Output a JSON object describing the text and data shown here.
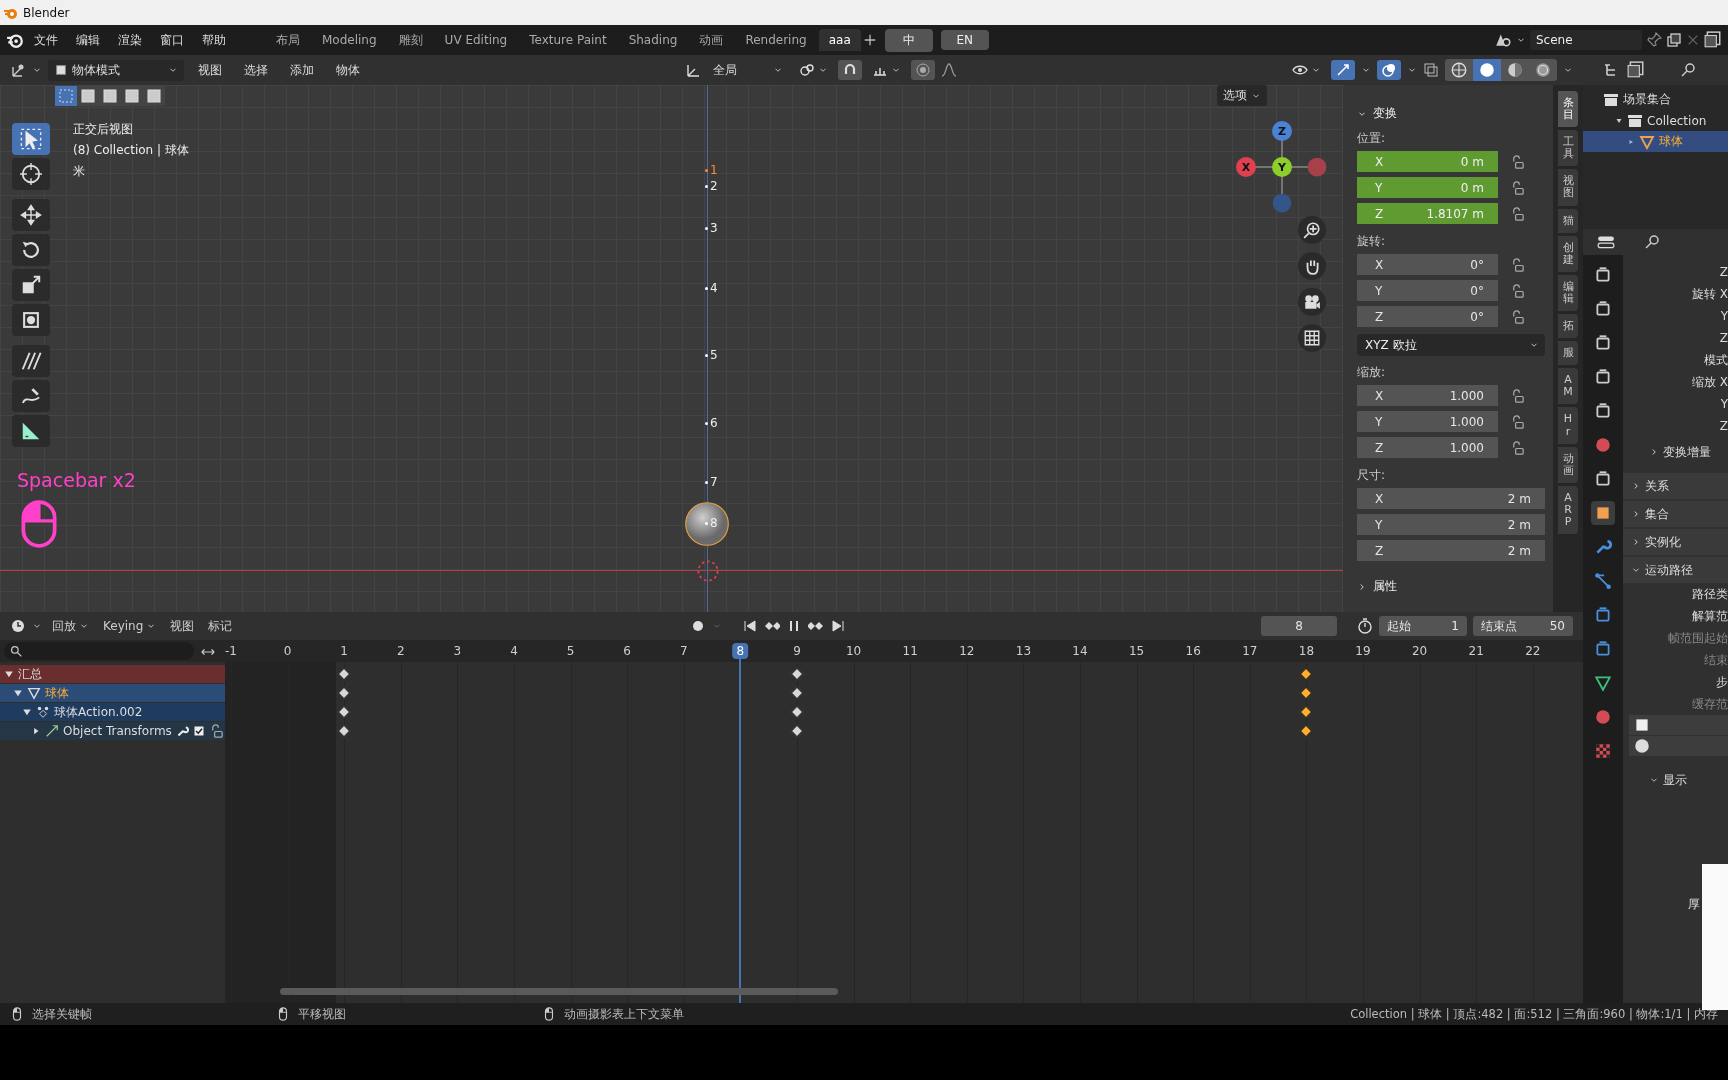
{
  "window": {
    "title": "Blender"
  },
  "menu": [
    "文件",
    "编辑",
    "渲染",
    "窗口",
    "帮助"
  ],
  "workspaces": [
    {
      "label": "布局",
      "selected": false
    },
    {
      "label": "Modeling",
      "selected": false
    },
    {
      "label": "雕刻",
      "selected": false
    },
    {
      "label": "UV Editing",
      "selected": false
    },
    {
      "label": "Texture Paint",
      "selected": false
    },
    {
      "label": "Shading",
      "selected": false
    },
    {
      "label": "动画",
      "selected": false
    },
    {
      "label": "Rendering",
      "selected": false
    },
    {
      "label": "aaa",
      "selected": true
    }
  ],
  "language_buttons": [
    "中",
    "EN"
  ],
  "scene": "Scene",
  "viewport": {
    "mode": "物体模式",
    "menus": [
      "视图",
      "选择",
      "添加",
      "物体"
    ],
    "orientation": "全局",
    "options": "选项",
    "select_modes": [
      {
        "selected": true
      },
      {
        "selected": false
      },
      {
        "selected": false
      },
      {
        "selected": false
      },
      {
        "selected": false
      }
    ],
    "toggles": [
      {
        "on": true
      },
      {
        "on": true
      }
    ],
    "shading_modes": [
      {
        "selected": false
      },
      {
        "selected": true
      },
      {
        "selected": false
      },
      {
        "selected": false
      }
    ],
    "tools": [
      {
        "selected": true
      },
      {
        "selected": false
      },
      {
        "selected": false
      },
      {
        "selected": false
      },
      {
        "selected": false
      },
      {
        "selected": false
      },
      {
        "selected": false
      },
      {
        "selected": false
      },
      {
        "selected": false
      }
    ],
    "info": [
      "正交后视图",
      "(8) Collection | 球体",
      "米"
    ],
    "gizmo": {
      "z": "Z",
      "y": "Y",
      "x": "X"
    },
    "motion_path": [
      {
        "label": "1",
        "selected": true
      },
      {
        "label": "2",
        "selected": false
      },
      {
        "label": "3",
        "selected": false
      },
      {
        "label": "4",
        "selected": false
      },
      {
        "label": "5",
        "selected": false
      },
      {
        "label": "6",
        "selected": false
      },
      {
        "label": "7",
        "selected": false
      },
      {
        "label": "8",
        "selected": false
      }
    ],
    "screencast": "Spacebar x2"
  },
  "sidebar": {
    "tabs": [
      {
        "label": "条目",
        "selected": true
      },
      {
        "label": "工具",
        "selected": false
      },
      {
        "label": "视图",
        "selected": false
      },
      {
        "label": "猫",
        "selected": false
      },
      {
        "label": "创建",
        "selected": false
      },
      {
        "label": "编辑",
        "selected": false
      },
      {
        "label": "拓",
        "selected": false
      },
      {
        "label": "服",
        "selected": false
      },
      {
        "label": "AM",
        "selected": false
      },
      {
        "label": "Hr",
        "selected": false
      },
      {
        "label": "动画",
        "selected": false
      },
      {
        "label": "ARP",
        "selected": false
      }
    ],
    "title": "变换",
    "location": {
      "label": "位置:",
      "fields": [
        {
          "axis": "X",
          "value": "0 m",
          "animated": true
        },
        {
          "axis": "Y",
          "value": "0 m",
          "animated": true
        },
        {
          "axis": "Z",
          "value": "1.8107 m",
          "animated": true
        }
      ]
    },
    "rotation": {
      "label": "旋转:",
      "fields": [
        {
          "axis": "X",
          "value": "0°",
          "animated": false
        },
        {
          "axis": "Y",
          "value": "0°",
          "animated": false
        },
        {
          "axis": "Z",
          "value": "0°",
          "animated": false
        }
      ]
    },
    "rotation_mode": "XYZ 欧拉",
    "scale": {
      "label": "缩放:",
      "fields": [
        {
          "axis": "X",
          "value": "1.000",
          "animated": false
        },
        {
          "axis": "Y",
          "value": "1.000",
          "animated": false
        },
        {
          "axis": "Z",
          "value": "1.000",
          "animated": false
        }
      ]
    },
    "dimensions": {
      "label": "尺寸:",
      "fields": [
        {
          "axis": "X",
          "value": "2 m",
          "animated": false
        },
        {
          "axis": "Y",
          "value": "2 m",
          "animated": false
        },
        {
          "axis": "Z",
          "value": "2 m",
          "animated": false
        }
      ]
    },
    "collapsed_panel": "属性"
  },
  "outliner": {
    "items": [
      {
        "label": "场景集合",
        "selected": false,
        "children": [
          {
            "label": "Collection",
            "selected": false,
            "children": [
              {
                "label": "球体",
                "selected": true
              }
            ]
          }
        ]
      }
    ]
  },
  "properties": {
    "tabs": [
      {
        "selected": false
      },
      {
        "selected": false
      },
      {
        "selected": false
      },
      {
        "selected": false
      },
      {
        "selected": false
      },
      {
        "selected": false
      },
      {
        "selected": false
      },
      {
        "selected": true
      },
      {
        "selected": false
      },
      {
        "selected": false
      },
      {
        "selected": false
      },
      {
        "selected": false
      },
      {
        "selected": false
      },
      {
        "selected": false
      },
      {
        "selected": false
      }
    ],
    "rows": [
      "Z",
      "旋转 X",
      "Y",
      "Z",
      "模式",
      "缩放 X",
      "Y",
      "Z"
    ],
    "panels": [
      {
        "label": "变换增量",
        "expanded": false,
        "kind": "sub"
      },
      {
        "label": "关系",
        "expanded": false,
        "kind": "main"
      },
      {
        "label": "集合",
        "expanded": false,
        "kind": "main"
      },
      {
        "label": "实例化",
        "expanded": false,
        "kind": "main"
      },
      {
        "label": "运动路径",
        "expanded": true,
        "kind": "main"
      }
    ],
    "motion_rows": [
      {
        "label": "路径类",
        "disabled": false
      },
      {
        "label": "解算范",
        "disabled": false
      },
      {
        "label": "帧范围起始",
        "disabled": true
      },
      {
        "label": "结束",
        "disabled": true
      },
      {
        "label": "步",
        "disabled": false
      },
      {
        "label": "缓存范",
        "disabled": true
      }
    ],
    "display": {
      "label": "显示",
      "expanded": true
    },
    "last_row": "厚"
  },
  "timeline": {
    "menus": [
      "回放",
      "Keying",
      "视图",
      "标记"
    ],
    "current_frame": "8",
    "start_label": "起始",
    "start": "1",
    "end_label": "结束点",
    "end": "50",
    "frames": [
      {
        "label": "-1",
        "selected": false,
        "key": false,
        "key_selected": false
      },
      {
        "label": "0",
        "selected": false,
        "key": false,
        "key_selected": false
      },
      {
        "label": "1",
        "selected": false,
        "key": true,
        "key_selected": false
      },
      {
        "label": "2",
        "selected": false,
        "key": false,
        "key_selected": false
      },
      {
        "label": "3",
        "selected": false,
        "key": false,
        "key_selected": false
      },
      {
        "label": "4",
        "selected": false,
        "key": false,
        "key_selected": false
      },
      {
        "label": "5",
        "selected": false,
        "key": false,
        "key_selected": false
      },
      {
        "label": "6",
        "selected": false,
        "key": false,
        "key_selected": false
      },
      {
        "label": "7",
        "selected": false,
        "key": false,
        "key_selected": false
      },
      {
        "label": "8",
        "selected": true,
        "key": false,
        "key_selected": false
      },
      {
        "label": "9",
        "selected": false,
        "key": true,
        "key_selected": false
      },
      {
        "label": "10",
        "selected": false,
        "key": false,
        "key_selected": false
      },
      {
        "label": "11",
        "selected": false,
        "key": false,
        "key_selected": false
      },
      {
        "label": "12",
        "selected": false,
        "key": false,
        "key_selected": false
      },
      {
        "label": "13",
        "selected": false,
        "key": false,
        "key_selected": false
      },
      {
        "label": "14",
        "selected": false,
        "key": false,
        "key_selected": false
      },
      {
        "label": "15",
        "selected": false,
        "key": false,
        "key_selected": false
      },
      {
        "label": "16",
        "selected": false,
        "key": false,
        "key_selected": false
      },
      {
        "label": "17",
        "selected": false,
        "key": false,
        "key_selected": false
      },
      {
        "label": "18",
        "selected": false,
        "key": true,
        "key_selected": true
      },
      {
        "label": "19",
        "selected": false,
        "key": false,
        "key_selected": false
      },
      {
        "label": "20",
        "selected": false,
        "key": false,
        "key_selected": false
      },
      {
        "label": "21",
        "selected": false,
        "key": false,
        "key_selected": false
      },
      {
        "label": "22",
        "selected": false,
        "key": false,
        "key_selected": false
      }
    ],
    "channels": [
      {
        "label": "汇总",
        "kind": "summary",
        "selected": false,
        "children": [
          {
            "label": "球体",
            "kind": "object",
            "selected": true,
            "children": [
              {
                "label": "球体Action.002",
                "kind": "action",
                "selected": false,
                "children": [
                  {
                    "label": "Object Transforms",
                    "kind": "group",
                    "selected": false
                  }
                ]
              }
            ]
          }
        ]
      }
    ]
  },
  "status_bar": {
    "hints": [
      "选择关键帧",
      "平移视图",
      "动画摄影表上下文菜单"
    ],
    "stats": "Collection | 球体 | 顶点:482 | 面:512 | 三角面:960 | 物体:1/1 | 内存"
  }
}
